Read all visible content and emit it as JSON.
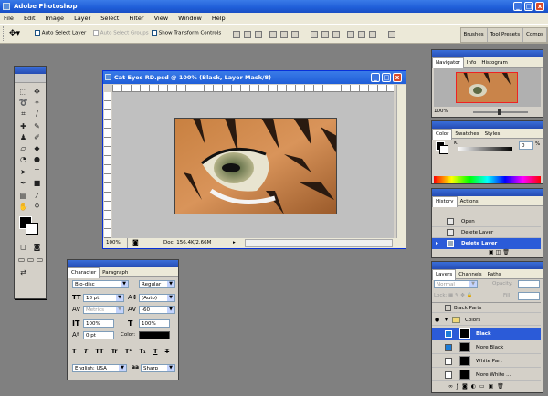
{
  "app": {
    "title": "Adobe Photoshop"
  },
  "window_controls": {
    "minimize": "_",
    "maximize": "□",
    "close": "x"
  },
  "menu": [
    "File",
    "Edit",
    "Image",
    "Layer",
    "Select",
    "Filter",
    "View",
    "Window",
    "Help"
  ],
  "options_bar": {
    "auto_select_layer": "Auto Select Layer",
    "auto_select_groups": "Auto Select Groups",
    "show_transform_controls": "Show Transform Controls",
    "palette_tabs": [
      "Brushes",
      "Tool Presets",
      "Comps"
    ]
  },
  "document": {
    "title": "Cat Eyes RD.psd @ 100% (Black, Layer Mask/8)",
    "zoom": "100%",
    "doc_info": "Doc: 156.4K/2.66M"
  },
  "navigator": {
    "tabs": [
      "Navigator",
      "Info",
      "Histogram"
    ],
    "zoom": "100%"
  },
  "color": {
    "tabs": [
      "Color",
      "Swatches",
      "Styles"
    ],
    "channel": "K",
    "value": "0",
    "unit": "%"
  },
  "history": {
    "tabs": [
      "History",
      "Actions"
    ],
    "items": [
      {
        "label": "Open",
        "selected": false
      },
      {
        "label": "Delete Layer",
        "selected": false
      },
      {
        "label": "Delete Layer",
        "selected": true
      }
    ]
  },
  "layers": {
    "tabs": [
      "Layers",
      "Channels",
      "Paths"
    ],
    "blend_mode": "Normal",
    "opacity_label": "Opacity:",
    "lock_label": "Lock:",
    "fill_label": "Fill:",
    "items": [
      {
        "label": "Black Parts",
        "group": false,
        "selected": false,
        "eye": false
      },
      {
        "label": "Colors",
        "group": true,
        "selected": false,
        "eye": true
      },
      {
        "label": "Black",
        "group": false,
        "selected": true,
        "eye": false
      },
      {
        "label": "More Black",
        "group": false,
        "selected": false,
        "eye": false
      },
      {
        "label": "White Part",
        "group": false,
        "selected": false,
        "eye": false
      },
      {
        "label": "More White ...",
        "group": false,
        "selected": false,
        "eye": false
      }
    ]
  },
  "character": {
    "tabs": [
      "Character",
      "Paragraph"
    ],
    "font_family": "Bio-disc",
    "font_style": "Regular",
    "size": "18 pt",
    "leading": "(Auto)",
    "kerning": "Metrics",
    "tracking": "-60",
    "vscale": "100%",
    "hscale": "100%",
    "baseline": "0 pt",
    "color_label": "Color:",
    "style_buttons": [
      "T",
      "T",
      "TT",
      "Tr",
      "T¹",
      "T₁",
      "T",
      "T"
    ],
    "language": "English: USA",
    "aa_label": "aa",
    "antialias": "Sharp"
  },
  "colors": {
    "accent": "#2b5bd8",
    "titlebar": "#1f5ed8",
    "panel_bg": "#d4d0c8"
  }
}
